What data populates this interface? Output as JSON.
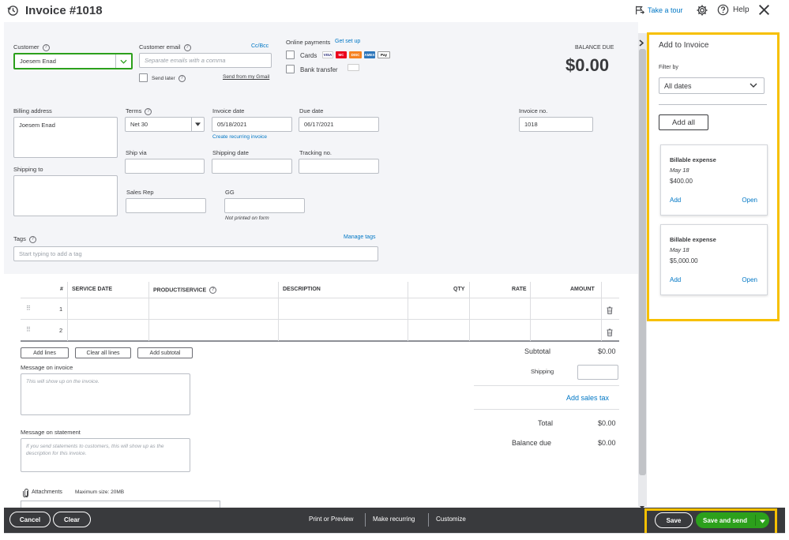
{
  "header": {
    "title": "Invoice #1018",
    "take_tour": "Take a tour",
    "help": "Help"
  },
  "customer": {
    "label": "Customer",
    "value": "Joesem Enad",
    "email_label": "Customer email",
    "email_placeholder": "Separate emails with a comma",
    "cc_bcc": "Cc/Bcc",
    "send_later": "Send later",
    "send_from_gmail": "Send from my Gmail"
  },
  "online_payments": {
    "label": "Online payments",
    "get_set_up": "Get set up",
    "cards": "Cards",
    "bank_transfer": "Bank transfer",
    "badges": [
      "VISA",
      "MC",
      "DISC",
      "AMEX",
      "Pay"
    ]
  },
  "balance": {
    "label": "BALANCE DUE",
    "value": "$0.00"
  },
  "billing": {
    "billing_label": "Billing address",
    "billing_value": "Joesem Enad",
    "shipping_label": "Shipping to",
    "terms_label": "Terms",
    "terms_value": "Net 30",
    "invoice_date_label": "Invoice date",
    "invoice_date_value": "05/18/2021",
    "create_recurring": "Create recurring invoice",
    "due_date_label": "Due date",
    "due_date_value": "06/17/2021",
    "invoice_no_label": "Invoice no.",
    "invoice_no_value": "1018",
    "ship_via_label": "Ship via",
    "shipping_date_label": "Shipping date",
    "tracking_label": "Tracking no.",
    "sales_rep_label": "Sales Rep",
    "gg_label": "GG",
    "not_printed": "Not printed on form"
  },
  "tags": {
    "label": "Tags",
    "manage": "Manage tags",
    "placeholder": "Start typing to add a tag"
  },
  "table": {
    "headers": [
      "#",
      "SERVICE DATE",
      "PRODUCT/SERVICE",
      "DESCRIPTION",
      "QTY",
      "RATE",
      "AMOUNT"
    ],
    "rows": [
      {
        "num": "1"
      },
      {
        "num": "2"
      }
    ]
  },
  "actions": {
    "add_lines": "Add lines",
    "clear_all_lines": "Clear all lines",
    "add_subtotal": "Add subtotal"
  },
  "messages": {
    "invoice_label": "Message on invoice",
    "invoice_placeholder": "This will show up on the invoice.",
    "statement_label": "Message on statement",
    "statement_placeholder": "If you send statements to customers, this will show up as the description for this invoice."
  },
  "attachments": {
    "label": "Attachments",
    "max_size": "Maximum size: 20MB"
  },
  "totals": {
    "subtotal_label": "Subtotal",
    "subtotal_value": "$0.00",
    "shipping_label": "Shipping",
    "add_sales_tax": "Add sales tax",
    "total_label": "Total",
    "total_value": "$0.00",
    "balance_due_label": "Balance due",
    "balance_due_value": "$0.00"
  },
  "sidebar": {
    "title": "Add to Invoice",
    "filter_label": "Filter by",
    "filter_value": "All dates",
    "add_all": "Add all",
    "cards": [
      {
        "title": "Billable expense",
        "date": "May 18",
        "amount": "$400.00",
        "add": "Add",
        "open": "Open"
      },
      {
        "title": "Billable expense",
        "date": "May 18",
        "amount": "$5,000.00",
        "add": "Add",
        "open": "Open"
      }
    ]
  },
  "footer": {
    "cancel": "Cancel",
    "clear": "Clear",
    "print_preview": "Print or Preview",
    "make_recurring": "Make recurring",
    "customize": "Customize",
    "save": "Save",
    "save_and_send": "Save and send"
  },
  "colors": {
    "accent_link": "#0077c5",
    "green": "#2ca01c",
    "highlight": "#f7c000",
    "footer_bg": "#393a3d",
    "form_bg": "#f4f5f8"
  }
}
